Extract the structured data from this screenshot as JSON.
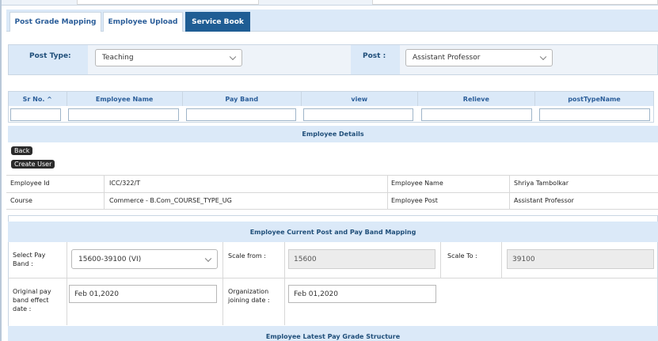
{
  "tabs": [
    {
      "label": "Post Grade Mapping"
    },
    {
      "label": "Employee Upload"
    },
    {
      "label": "Service Book"
    }
  ],
  "filters": {
    "post_type_label": "Post Type:",
    "post_type_value": "Teaching",
    "post_label": "Post :",
    "post_value": "Assistant Professor"
  },
  "grid": {
    "columns": [
      "Sr No. ^",
      "Employee Name",
      "Pay Band",
      "view",
      "Relieve",
      "postTypeName"
    ]
  },
  "employee_details": {
    "header": "Employee Details",
    "back_label": "Back",
    "create_user_label": "Create User",
    "rows": [
      [
        "Employee Id",
        "ICC/322/T",
        "Employee Name",
        "Shriya Tambolkar"
      ],
      [
        "Course",
        "Commerce - B.Com_COURSE_TYPE_UG",
        "Employee Post",
        "Assistant Professor"
      ]
    ]
  },
  "pay_mapping": {
    "header": "Employee Current Post and Pay Band Mapping",
    "select_pay_band_label": "Select Pay Band :",
    "select_pay_band_value": "15600-39100 (VI)",
    "scale_from_label": "Scale from :",
    "scale_from_value": "15600",
    "scale_to_label": "Scale To :",
    "scale_to_value": "39100",
    "orig_effect_label": "Original pay band effect date :",
    "orig_effect_value": "Feb 01,2020",
    "org_join_label": "Organization joining date :",
    "org_join_value": "Feb 01,2020"
  },
  "latest_structure": {
    "header": "Employee Latest Pay Grade Structure"
  }
}
